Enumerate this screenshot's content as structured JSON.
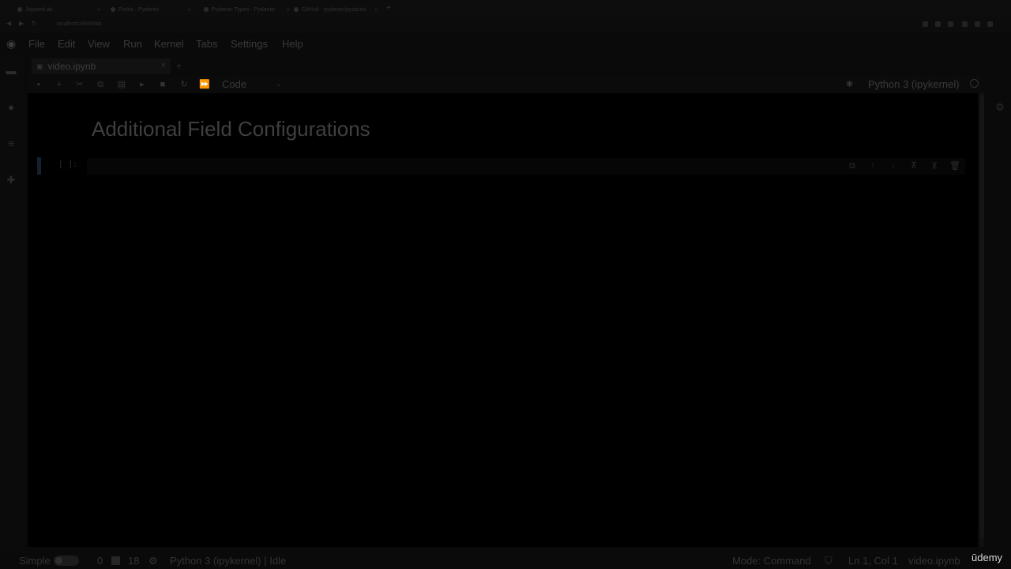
{
  "browser": {
    "tabs": [
      {
        "title": "JupyterLab"
      },
      {
        "title": "Fields - Pydantic"
      },
      {
        "title": "Pydantic Types - Pydantic"
      },
      {
        "title": "GitHub - pydantic/pydantic"
      }
    ],
    "new_tab_symbol": "+",
    "url": "localhost:8888/lab"
  },
  "menu": {
    "items": [
      "File",
      "Edit",
      "View",
      "Run",
      "Kernel",
      "Tabs",
      "Settings",
      "Help"
    ]
  },
  "document_tab": {
    "title": "video.ipynb",
    "close_symbol": "×",
    "new_tab_symbol": "+"
  },
  "toolbar": {
    "cell_type": "Code",
    "kernel": "Python 3 (ipykernel)"
  },
  "notebook": {
    "heading": "Additional Field Configurations",
    "active_cell": {
      "prompt": "[ ]:"
    }
  },
  "statusbar": {
    "mode_label": "Simple",
    "terminals_count": "0",
    "kernels_count": "18",
    "kernel_status": "Python 3 (ipykernel) | Idle",
    "mode": "Mode: Command",
    "cursor": "Ln 1, Col 1",
    "filename": "video.ipynb"
  },
  "watermark": "ūdemy",
  "colors": {
    "background": "#0a0a0a",
    "notebook_bg": "#000000",
    "text_dim": "#3a3a3a",
    "cell_collapser": "#13202e"
  }
}
